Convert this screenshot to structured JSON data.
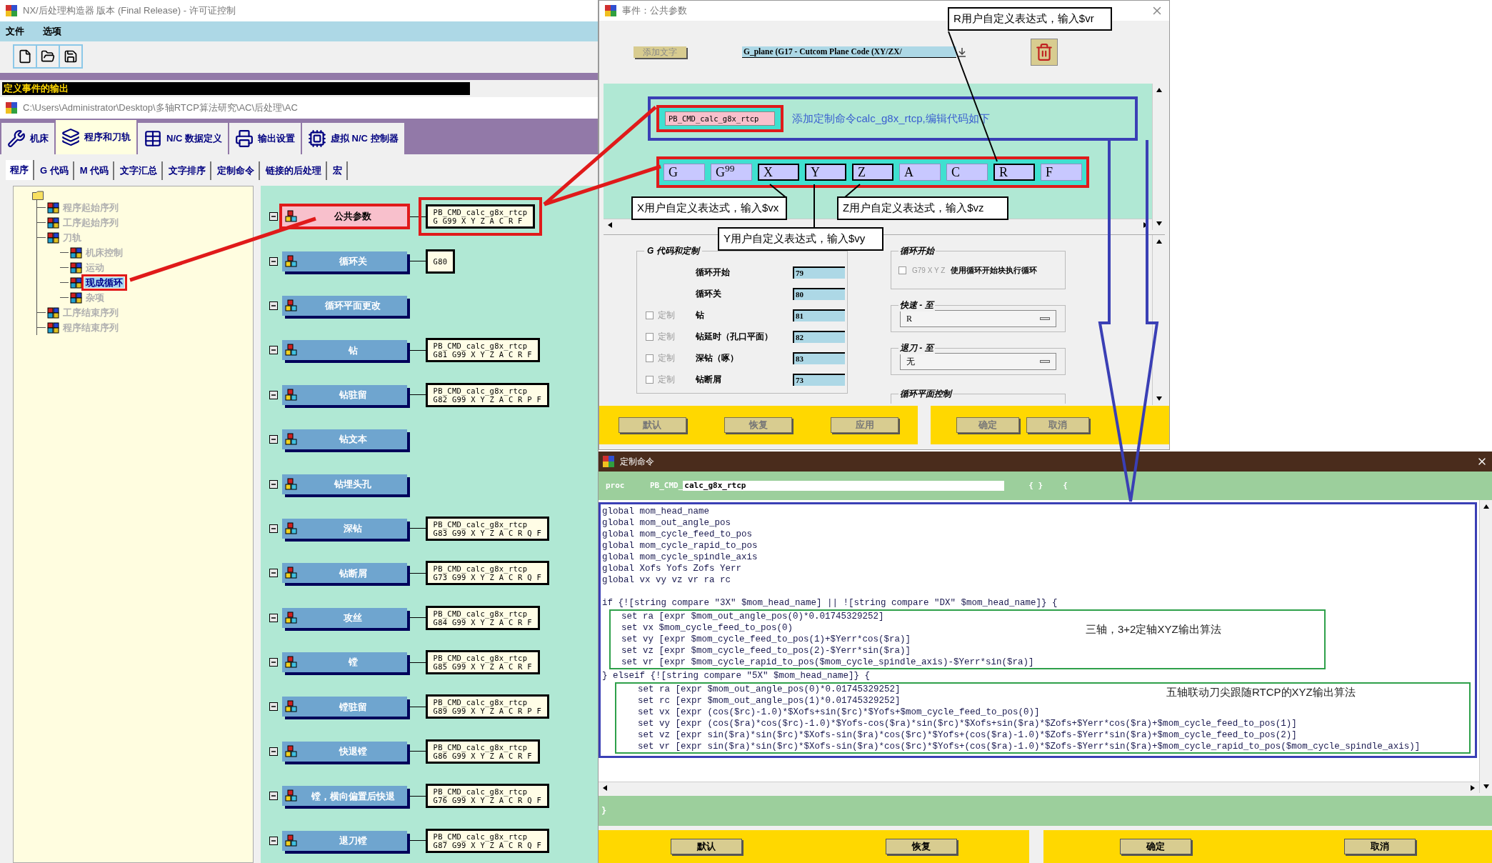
{
  "main_window": {
    "title": "NX/后处理构造器 版本 (Final Release) - 许可证控制",
    "menu": [
      "文件",
      "选项"
    ],
    "section_title": "定义事件的输出",
    "path": "C:\\Users\\Administrator\\Desktop\\多轴RTCP算法研究\\AC\\后处理\\AC",
    "main_tabs": [
      {
        "label": "机床",
        "selected": false
      },
      {
        "label": "程序和刀轨",
        "selected": true
      },
      {
        "label": "N/C 数据定义",
        "selected": false
      },
      {
        "label": "输出设置",
        "selected": false
      },
      {
        "label": "虚拟 N/C 控制器",
        "selected": false
      }
    ],
    "sub_tabs": [
      {
        "label": "程序",
        "selected": true
      },
      {
        "label": "G 代码",
        "selected": false
      },
      {
        "label": "M 代码",
        "selected": false
      },
      {
        "label": "文字汇总",
        "selected": false
      },
      {
        "label": "文字排序",
        "selected": false
      },
      {
        "label": "定制命令",
        "selected": false
      },
      {
        "label": "链接的后处理",
        "selected": false
      },
      {
        "label": "宏",
        "selected": false
      }
    ],
    "tree": [
      {
        "label": "程序起始序列",
        "selected": false
      },
      {
        "label": "工序起始序列",
        "selected": false
      },
      {
        "label": "刀轨",
        "selected": false,
        "children": [
          {
            "label": "机床控制",
            "selected": false
          },
          {
            "label": "运动",
            "selected": false
          },
          {
            "label": "现成循环",
            "selected": true
          },
          {
            "label": "杂项",
            "selected": false
          }
        ]
      },
      {
        "label": "工序结束序列",
        "selected": false
      },
      {
        "label": "程序结束序列",
        "selected": false
      }
    ],
    "events": [
      {
        "label": "公共参数",
        "selected": true,
        "output": [
          "PB_CMD_calc_g8x_rtcp",
          "G G99 X Y Z A C R F"
        ]
      },
      {
        "label": "循环关",
        "selected": false,
        "output": [
          "G80"
        ]
      },
      {
        "label": "循环平面更改",
        "selected": false
      },
      {
        "label": "钻",
        "selected": false,
        "output": [
          "PB_CMD_calc_g8x_rtcp",
          "G81 G99 X Y Z A C R F"
        ]
      },
      {
        "label": "钻驻留",
        "selected": false,
        "output": [
          "PB_CMD_calc_g8x_rtcp",
          "G82 G99 X Y Z A C R P F"
        ]
      },
      {
        "label": "钻文本",
        "selected": false
      },
      {
        "label": "钻埋头孔",
        "selected": false
      },
      {
        "label": "深钻",
        "selected": false,
        "output": [
          "PB_CMD_calc_g8x_rtcp",
          "G83 G99 X Y Z A C R Q F"
        ]
      },
      {
        "label": "钻断屑",
        "selected": false,
        "output": [
          "PB_CMD_calc_g8x_rtcp",
          "G73 G99 X Y Z A C R Q F"
        ]
      },
      {
        "label": "攻丝",
        "selected": false,
        "output": [
          "PB_CMD_calc_g8x_rtcp",
          "G84 G99 X Y Z A C R F"
        ]
      },
      {
        "label": "镗",
        "selected": false,
        "output": [
          "PB_CMD_calc_g8x_rtcp",
          "G85 G99 X Y Z A C R F"
        ]
      },
      {
        "label": "镗驻留",
        "selected": false,
        "output": [
          "PB_CMD_calc_g8x_rtcp",
          "G89 G99 X Y Z A C R P F"
        ]
      },
      {
        "label": "快退镗",
        "selected": false,
        "output": [
          "PB_CMD_calc_g8x_rtcp",
          "G86 G99 X Y Z A C R F"
        ]
      },
      {
        "label": "镗，横向偏置后快退",
        "selected": false,
        "output": [
          "PB_CMD_calc_g8x_rtcp",
          "G76 G99 X Y Z A C R Q F"
        ]
      },
      {
        "label": "退刀镗",
        "selected": false,
        "output": [
          "PB_CMD_calc_g8x_rtcp",
          "G87 G99 X Y Z A C R Q F"
        ]
      }
    ]
  },
  "event_dialog": {
    "title": "事件：公共参数",
    "add_word_button": "添加文字",
    "word_select": "G_plane (G17 - Cutcom Plane Code (XY/ZX/",
    "command_block": "PB_CMD_calc_g8x_rtcp",
    "command_note": "添加定制命令calc_g8x_rtcp,编辑代码如下",
    "words": [
      {
        "label": "G",
        "callout": false
      },
      {
        "label": "G$^{99}$",
        "callout": false
      },
      {
        "label": "X",
        "callout": true
      },
      {
        "label": "Y",
        "callout": true
      },
      {
        "label": "Z",
        "callout": true
      },
      {
        "label": "A",
        "callout": false
      },
      {
        "label": "C",
        "callout": false
      },
      {
        "label": "R",
        "callout": true
      },
      {
        "label": "F",
        "callout": false
      }
    ],
    "callouts": [
      "R用户自定义表达式，输入$vr",
      "X用户自定义表达式，输入$vx",
      "Z用户自定义表达式，输入$vz",
      "Y用户自定义表达式，输入$vy"
    ],
    "g_code_group": {
      "title": "G 代码和定制",
      "rows": [
        {
          "kind": "plain",
          "label": "循环开始",
          "value": "79"
        },
        {
          "kind": "plain",
          "label": "循环关",
          "value": "80"
        },
        {
          "kind": "custom",
          "custom_label": "定制",
          "checked": false,
          "label": "钻",
          "value": "81"
        },
        {
          "kind": "custom",
          "custom_label": "定制",
          "checked": false,
          "label": "钻延时（孔口平面）",
          "value": "82"
        },
        {
          "kind": "custom",
          "custom_label": "定制",
          "checked": false,
          "label": "深钻（啄）",
          "value": "83"
        },
        {
          "kind": "custom",
          "custom_label": "定制",
          "checked": false,
          "label": "钻断屑",
          "value": "73"
        }
      ]
    },
    "cycle_start_group": {
      "title": "循环开始",
      "checkbox_label": "G79 X Y Z",
      "checked": false,
      "description": "使用循环开始块执行循环"
    },
    "rapid_to": {
      "title": "快速 - 至",
      "value": "R"
    },
    "retract_to": {
      "title": "退刀 - 至",
      "value": "无"
    },
    "plane_control": {
      "title": "循环平面控制"
    },
    "left_buttons": [
      "默认",
      "恢复",
      "应用"
    ],
    "right_buttons": [
      "确定",
      "取消"
    ]
  },
  "command_dialog": {
    "title": "定制命令",
    "proc_keyword": "proc",
    "prefix": "PB_CMD_",
    "name": "calc_g8x_rtcp",
    "args": "{ }",
    "open_brace": "{",
    "code_sections": [
      {
        "kind": "block",
        "lines": [
          "global mom_head_name",
          "global mom_out_angle_pos",
          "global mom_cycle_feed_to_pos",
          "global mom_cycle_rapid_to_pos",
          "global mom_cycle_spindle_axis",
          "global Xofs Yofs Zofs Yerr",
          "global vx vy vz vr ra rc"
        ]
      },
      {
        "kind": "line",
        "lines": [
          "if {![string compare \"3X\" $mom_head_name] || ![string compare \"DX\" $mom_head_name]} {"
        ]
      },
      {
        "kind": "annotated",
        "note": "三轴，3+2定轴XYZ输出算法",
        "lines": [
          "  set ra [expr $mom_out_angle_pos(0)*0.01745329252]",
          "  set vx $mom_cycle_feed_to_pos(0)",
          "  set vy [expr $mom_cycle_feed_to_pos(1)+$Yerr*cos($ra)]",
          "  set vz [expr $mom_cycle_feed_to_pos(2)-$Yerr*sin($ra)]",
          "  set vr [expr $mom_cycle_rapid_to_pos($mom_cycle_spindle_axis)-$Yerr*sin($ra)]"
        ]
      },
      {
        "kind": "line",
        "lines": [
          "} elseif {![string compare \"5X\" $mom_head_name]} {"
        ]
      },
      {
        "kind": "annotated",
        "note": "五轴联动刀尖跟随RTCP的XYZ输出算法",
        "lines": [
          "    set ra [expr $mom_out_angle_pos(0)*0.01745329252]",
          "    set rc [expr $mom_out_angle_pos(1)*0.01745329252]",
          "    set vx [expr (cos($rc)-1.0)*$Xofs+sin($rc)*$Yofs+$mom_cycle_feed_to_pos(0)]",
          "    set vy [expr (cos($ra)*cos($rc)-1.0)*$Yofs-cos($ra)*sin($rc)*$Xofs+sin($ra)*$Zofs+$Yerr*cos($ra)+$mom_cycle_feed_to_pos(1)]",
          "    set vz [expr sin($ra)*sin($rc)*$Xofs-sin($ra)*cos($rc)*$Yofs+(cos($ra)-1.0)*$Zofs-$Yerr*sin($ra)+$mom_cycle_feed_to_pos(2)]",
          "    set vr [expr sin($ra)*sin($rc)*$Xofs-sin($ra)*cos($rc)*$Yofs+(cos($ra)-1.0)*$Zofs-$Yerr*sin($ra)+$mom_cycle_rapid_to_pos($mom_cycle_spindle_axis)]"
        ]
      }
    ],
    "close_brace": "}",
    "left_buttons": [
      "默认",
      "恢复"
    ],
    "right_buttons": [
      "确定",
      "取消"
    ]
  }
}
